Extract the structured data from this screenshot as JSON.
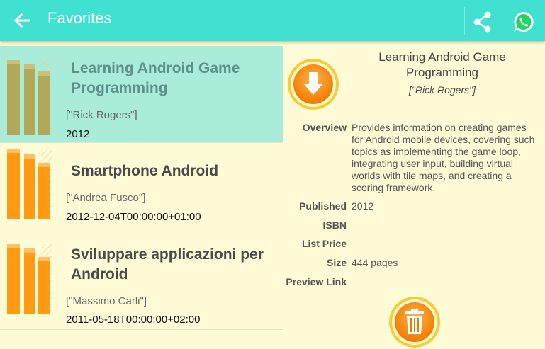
{
  "appbar": {
    "title": "Favorites",
    "icons": [
      "back-arrow-icon",
      "share-icon",
      "whatsapp-icon"
    ]
  },
  "colors": {
    "appbar": "#41e1d1",
    "background": "#fffbd6",
    "selected": "#a8ecd9",
    "book_selected": "#b2a85a",
    "book_normal": "#ff9a12"
  },
  "books": [
    {
      "title": "Learning Android Game Programming",
      "authors": "[\"Rick Rogers\"]",
      "date": "2012",
      "selected": true
    },
    {
      "title": "Smartphone Android",
      "authors": "[\"Andrea Fusco\"]",
      "date": "2012-12-04T00:00:00+01:00",
      "selected": false
    },
    {
      "title": "Sviluppare applicazioni per Android",
      "authors": "[\"Massimo Carli\"]",
      "date": "2011-05-18T00:00:00+02:00",
      "selected": false
    }
  ],
  "detail": {
    "title": "Learning Android Game Programming",
    "authors": "[\"Rick Rogers\"]",
    "labels": {
      "overview": "Overview",
      "published": "Published",
      "isbn": "ISBN",
      "list_price": "List Price",
      "size": "Size",
      "preview_link": "Preview Link"
    },
    "overview": "Provides information on creating games for Android mobile devices, covering such topics as implementing the game loop, integrating user input, building virtual worlds with tile maps, and creating a scoring framework.",
    "published": "2012",
    "isbn": "",
    "list_price": "",
    "size": "444 pages",
    "preview_link": "",
    "icons": [
      "download-icon",
      "trash-icon"
    ]
  }
}
